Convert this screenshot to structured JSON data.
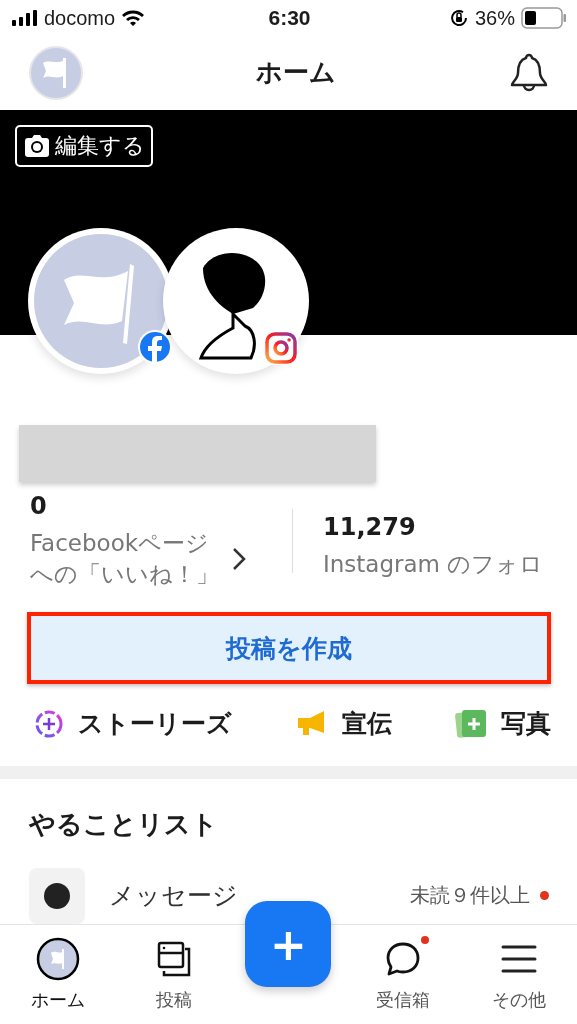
{
  "status_bar": {
    "carrier": "docomo",
    "time": "6:30",
    "battery": "36%"
  },
  "header": {
    "title": "ホーム"
  },
  "cover": {
    "edit_button": "編集する"
  },
  "stats": [
    {
      "value": "0",
      "label_lines": [
        "Facebookページ",
        "への「いいね！」"
      ],
      "chevron": true
    },
    {
      "value": "11,279",
      "label_lines": [
        "Instagram のフォロ"
      ],
      "chevron": false
    }
  ],
  "create_post_button": "投稿を作成",
  "actions": [
    {
      "kind": "story",
      "label": "ストーリーズ"
    },
    {
      "kind": "ad",
      "label": "宣伝"
    },
    {
      "kind": "photo",
      "label": "写真"
    }
  ],
  "todo": {
    "title": "やることリスト",
    "items": [
      {
        "label": "メッセージ",
        "status": "未読９件以上",
        "unread": true
      }
    ]
  },
  "tab_bar": {
    "add_button": "+",
    "tabs": [
      {
        "kind": "home",
        "label": "ホーム",
        "selected": true,
        "unread": false
      },
      {
        "kind": "posts",
        "label": "投稿",
        "selected": false,
        "unread": false
      },
      {
        "kind": "inbox",
        "label": "受信箱",
        "selected": false,
        "unread": true
      },
      {
        "kind": "more",
        "label": "その他",
        "selected": false,
        "unread": false
      }
    ]
  }
}
